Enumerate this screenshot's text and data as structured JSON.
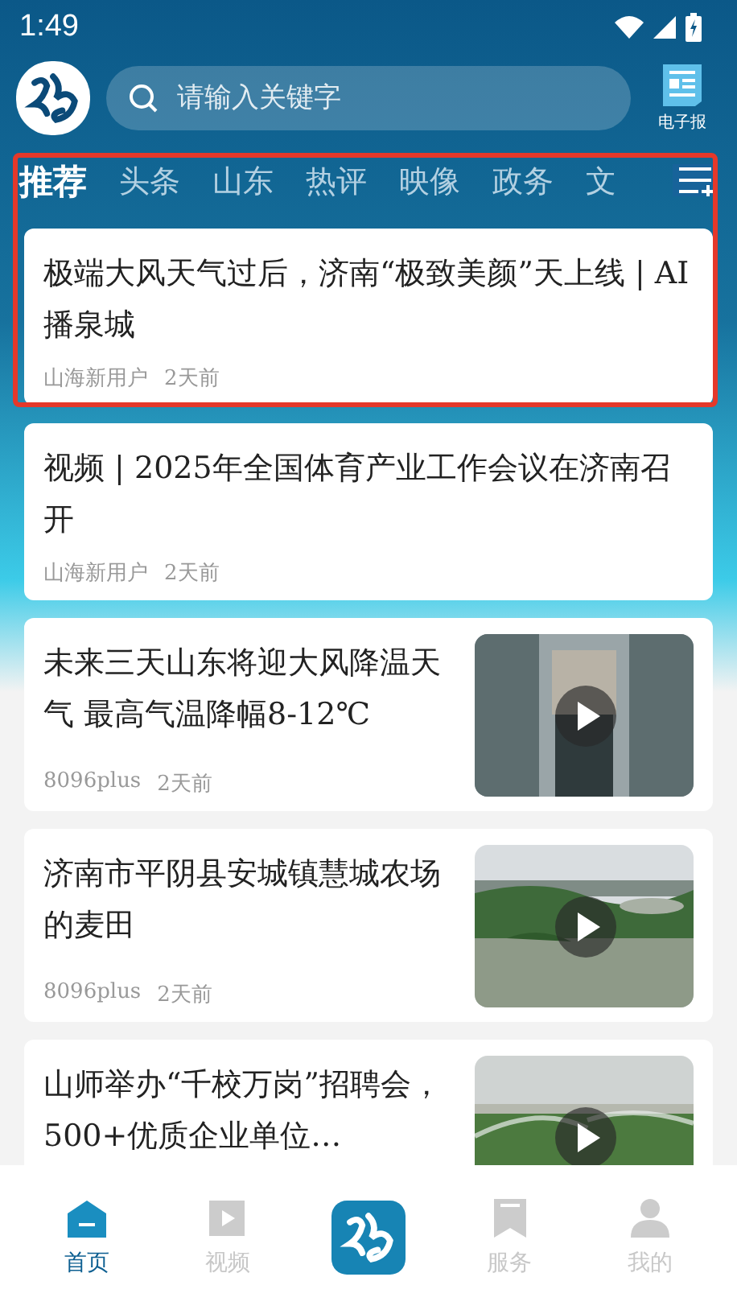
{
  "status_bar": {
    "time": "1:49"
  },
  "header": {
    "search": {
      "placeholder": "请输入关键字"
    },
    "epaper_label": "电子报"
  },
  "tabs": [
    {
      "label": "推荐",
      "selected": true
    },
    {
      "label": "头条",
      "selected": false
    },
    {
      "label": "山东",
      "selected": false
    },
    {
      "label": "热评",
      "selected": false
    },
    {
      "label": "映像",
      "selected": false
    },
    {
      "label": "政务",
      "selected": false
    },
    {
      "label": "文",
      "selected": false
    }
  ],
  "articles": [
    {
      "title": "极端大风天气过后，济南“极致美颜”天上线 | AI播泉城",
      "source": "山海新用户",
      "time": "2天前"
    },
    {
      "title": "视频 | 2025年全国体育产业工作会议在济南召开",
      "source": "山海新用户",
      "time": "2天前"
    },
    {
      "title": "未来三天山东将迎大风降温天气 最高气温降幅8-12℃",
      "source": "8096plus",
      "time": "2天前",
      "thumbnail": {
        "kind": "picture",
        "video": true
      }
    },
    {
      "title": "济南市平阴县安城镇慧城农场的麦田",
      "source": "8096plus",
      "time": "2天前",
      "thumbnail": {
        "kind": "picture",
        "video": true
      }
    },
    {
      "title": "山师举办“千校万岗”招聘会，500+优质企业单位…",
      "thumbnail": {
        "kind": "picture",
        "video": true
      }
    }
  ],
  "bottom_nav": [
    {
      "kind": "home",
      "label": "首页",
      "selected": true
    },
    {
      "kind": "video",
      "label": "视频",
      "selected": false
    },
    {
      "kind": "logo"
    },
    {
      "kind": "bookmark",
      "label": "服务",
      "selected": false
    },
    {
      "kind": "person",
      "label": "我的",
      "selected": false
    }
  ]
}
